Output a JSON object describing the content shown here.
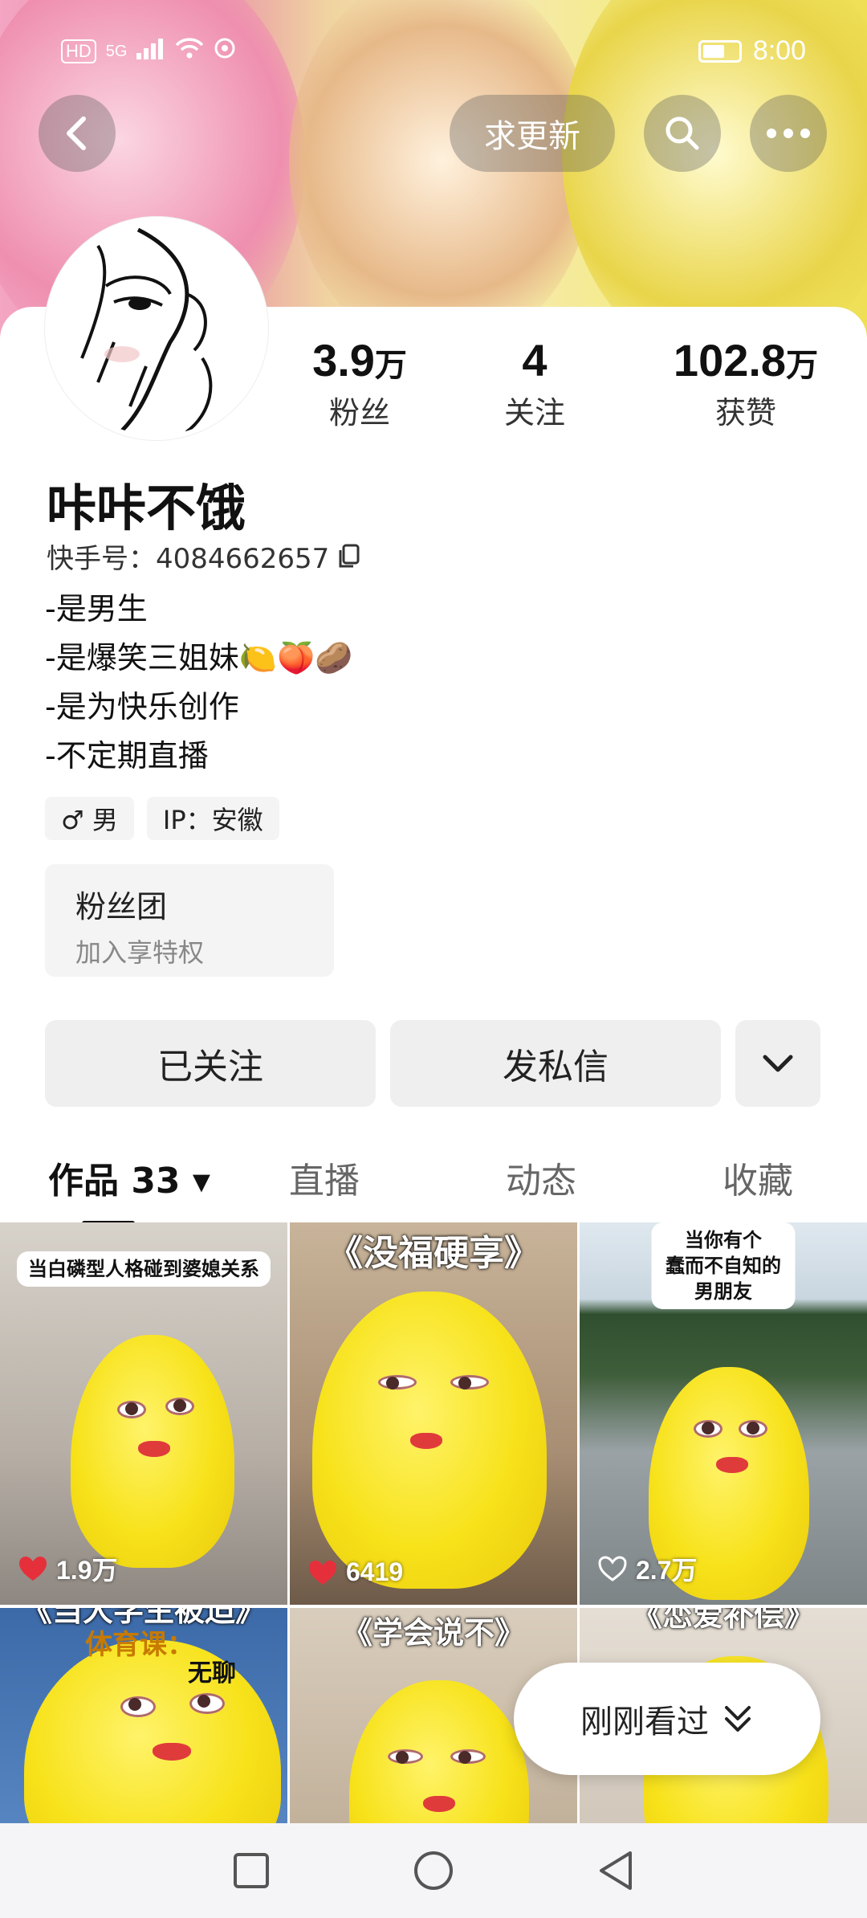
{
  "status_bar": {
    "network_badge": "HD",
    "signal": "5G",
    "time": "8:00"
  },
  "header": {
    "update_button": "求更新"
  },
  "profile": {
    "name": "咔咔不饿",
    "uid_label": "快手号：4084662657",
    "stats": [
      {
        "value": "3.9",
        "unit": "万",
        "label": "粉丝"
      },
      {
        "value": "4",
        "unit": "",
        "label": "关注"
      },
      {
        "value": "102.8",
        "unit": "万",
        "label": "获赞"
      }
    ],
    "bio": [
      "-是男生",
      "-是爆笑三姐妹🍋🍑🥔",
      "-是为快乐创作",
      "-不定期直播"
    ],
    "tags": [
      "♂ 男",
      "IP：安徽"
    ],
    "fan_club": {
      "title": "粉丝团",
      "subtitle": "加入享特权"
    }
  },
  "actions": {
    "follow": "已关注",
    "message": "发私信"
  },
  "tabs": [
    {
      "label": "作品 33 ▾",
      "active": true
    },
    {
      "label": "直播",
      "active": false
    },
    {
      "label": "动态",
      "active": false
    },
    {
      "label": "收藏",
      "active": false
    }
  ],
  "videos": [
    {
      "caption": "当白磷型人格碰到婆媳关系",
      "likes": "1.9万",
      "liked": true
    },
    {
      "title": "《没福硬享》",
      "likes": "6419",
      "liked": true
    },
    {
      "caption": "当你有个\n蠢而不自知的男朋友",
      "likes": "2.7万",
      "liked": false
    },
    {
      "title": "《当大学生被迫》",
      "sub1": "体育课：",
      "sub2": "无聊"
    },
    {
      "title": "《学会说不》"
    },
    {
      "title": "《恋爱补偿》"
    }
  ],
  "recent_button": "刚刚看过",
  "colors": {
    "like_red": "#e5303c",
    "accent_yellow": "#f7e21a"
  }
}
